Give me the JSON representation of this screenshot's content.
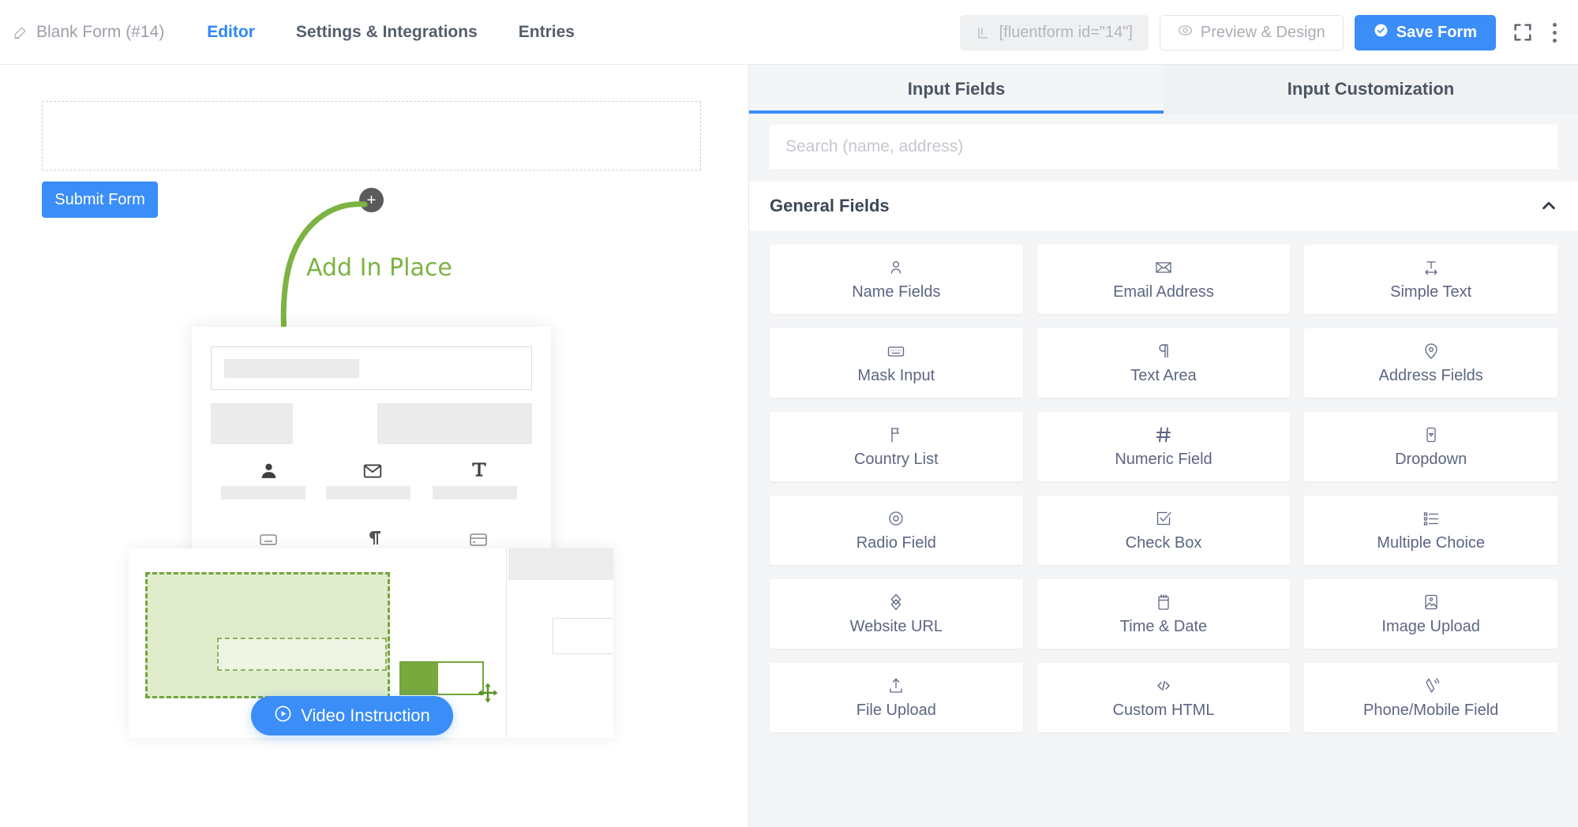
{
  "topbar": {
    "form_title": "Blank Form (#14)",
    "pencil_icon": "pencil-icon",
    "nav": [
      {
        "label": "Editor",
        "active": true
      },
      {
        "label": "Settings & Integrations",
        "active": false
      },
      {
        "label": "Entries",
        "active": false
      }
    ],
    "shortcode": "[fluentform id=\"14\"]",
    "shortcode_icon": "shortcode-icon",
    "preview_label": "Preview & Design",
    "preview_icon": "eye-icon",
    "save_label": "Save Form",
    "save_icon": "check-circle-icon",
    "expand_icon": "fullscreen-icon",
    "kebab_icon": "more-vertical-icon",
    "accent_blue": "#3b8df8"
  },
  "canvas": {
    "dropzone_name": "empty-drop-zone",
    "submit_label": "Submit Form",
    "plus_label": "+",
    "annotation": "Add In Place",
    "annotation_color": "#7cb342",
    "video_label": "Video Instruction",
    "video_icon": "play-circle-icon"
  },
  "panel": {
    "tabs": [
      {
        "label": "Input Fields",
        "active": true
      },
      {
        "label": "Input Customization",
        "active": false
      }
    ],
    "search": {
      "placeholder": "Search (name, address)",
      "value": ""
    },
    "group": {
      "title": "General Fields",
      "collapse_icon": "chevron-up-icon",
      "fields": [
        {
          "label": "Name Fields",
          "icon": "user-icon"
        },
        {
          "label": "Email Address",
          "icon": "envelope-icon"
        },
        {
          "label": "Simple Text",
          "icon": "text-width-icon"
        },
        {
          "label": "Mask Input",
          "icon": "keyboard-icon"
        },
        {
          "label": "Text Area",
          "icon": "paragraph-icon"
        },
        {
          "label": "Address Fields",
          "icon": "map-pin-icon"
        },
        {
          "label": "Country List",
          "icon": "flag-icon"
        },
        {
          "label": "Numeric Field",
          "icon": "hash-icon"
        },
        {
          "label": "Dropdown",
          "icon": "dropdown-caret-icon"
        },
        {
          "label": "Radio Field",
          "icon": "radio-circle-icon"
        },
        {
          "label": "Check Box",
          "icon": "check-square-icon"
        },
        {
          "label": "Multiple Choice",
          "icon": "list-checks-icon"
        },
        {
          "label": "Website URL",
          "icon": "link-diamond-icon"
        },
        {
          "label": "Time & Date",
          "icon": "calendar-icon"
        },
        {
          "label": "Image Upload",
          "icon": "image-icon"
        },
        {
          "label": "File Upload",
          "icon": "upload-icon"
        },
        {
          "label": "Custom HTML",
          "icon": "code-icon"
        },
        {
          "label": "Phone/Mobile Field",
          "icon": "phone-signal-icon"
        }
      ]
    }
  }
}
